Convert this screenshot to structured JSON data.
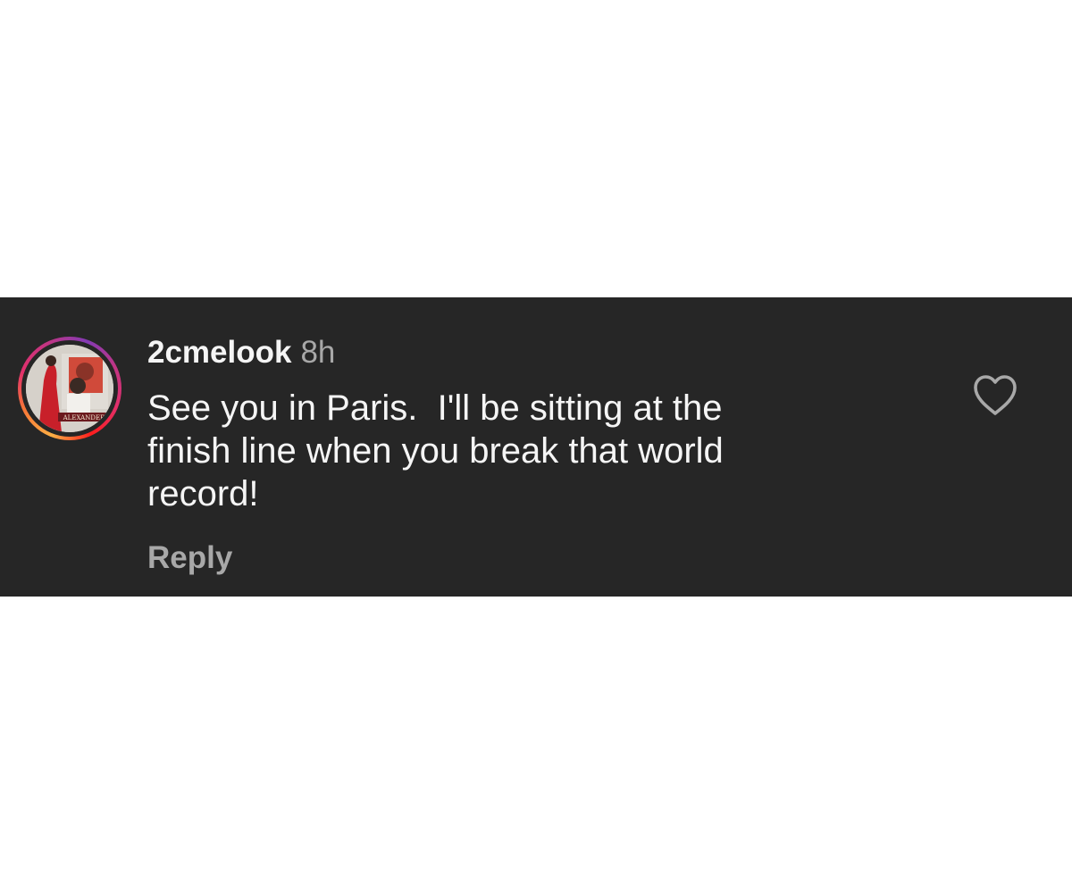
{
  "comment": {
    "username": "2cmelook",
    "timestamp": "8h",
    "text_lines": [
      "See you in Paris.  I'll be sitting at the",
      "finish line when you break that world",
      "record!"
    ],
    "reply_label": "Reply",
    "avatar_caption": "ALEXANDER",
    "like_icon": "heart-outline-icon"
  },
  "colors": {
    "panel_background": "#262626",
    "primary_text": "#f5f5f5",
    "secondary_text": "#a8a8a8",
    "story_ring": [
      "#fcaf45",
      "#f77737",
      "#e1306c",
      "#c13584",
      "#833ab4"
    ]
  }
}
